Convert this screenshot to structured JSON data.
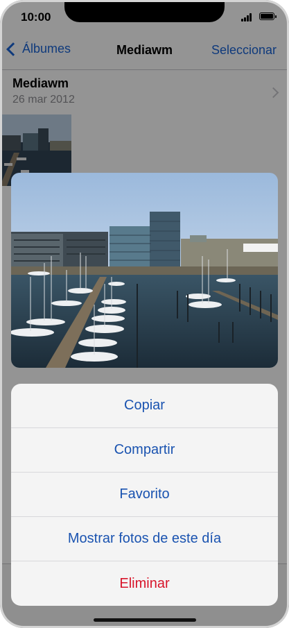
{
  "status_bar": {
    "time": "10:00",
    "signal_icon": "cellular-signal-icon",
    "battery_icon": "battery-icon"
  },
  "nav": {
    "back_label": "Álbumes",
    "back_icon": "chevron-left-icon",
    "title": "Mediawm",
    "select_label": "Seleccionar"
  },
  "album": {
    "name": "Mediawm",
    "date": "26 mar 2012",
    "chevron_icon": "chevron-right-icon"
  },
  "action_sheet": {
    "items": [
      {
        "label": "Copiar",
        "style": "default"
      },
      {
        "label": "Compartir",
        "style": "default"
      },
      {
        "label": "Favorito",
        "style": "default"
      },
      {
        "label": "Mostrar fotos de este día",
        "style": "default"
      },
      {
        "label": "Eliminar",
        "style": "destructive"
      }
    ]
  },
  "colors": {
    "accent": "#1a53b0",
    "destructive": "#d7142a",
    "secondary_text": "#8e8e93"
  }
}
